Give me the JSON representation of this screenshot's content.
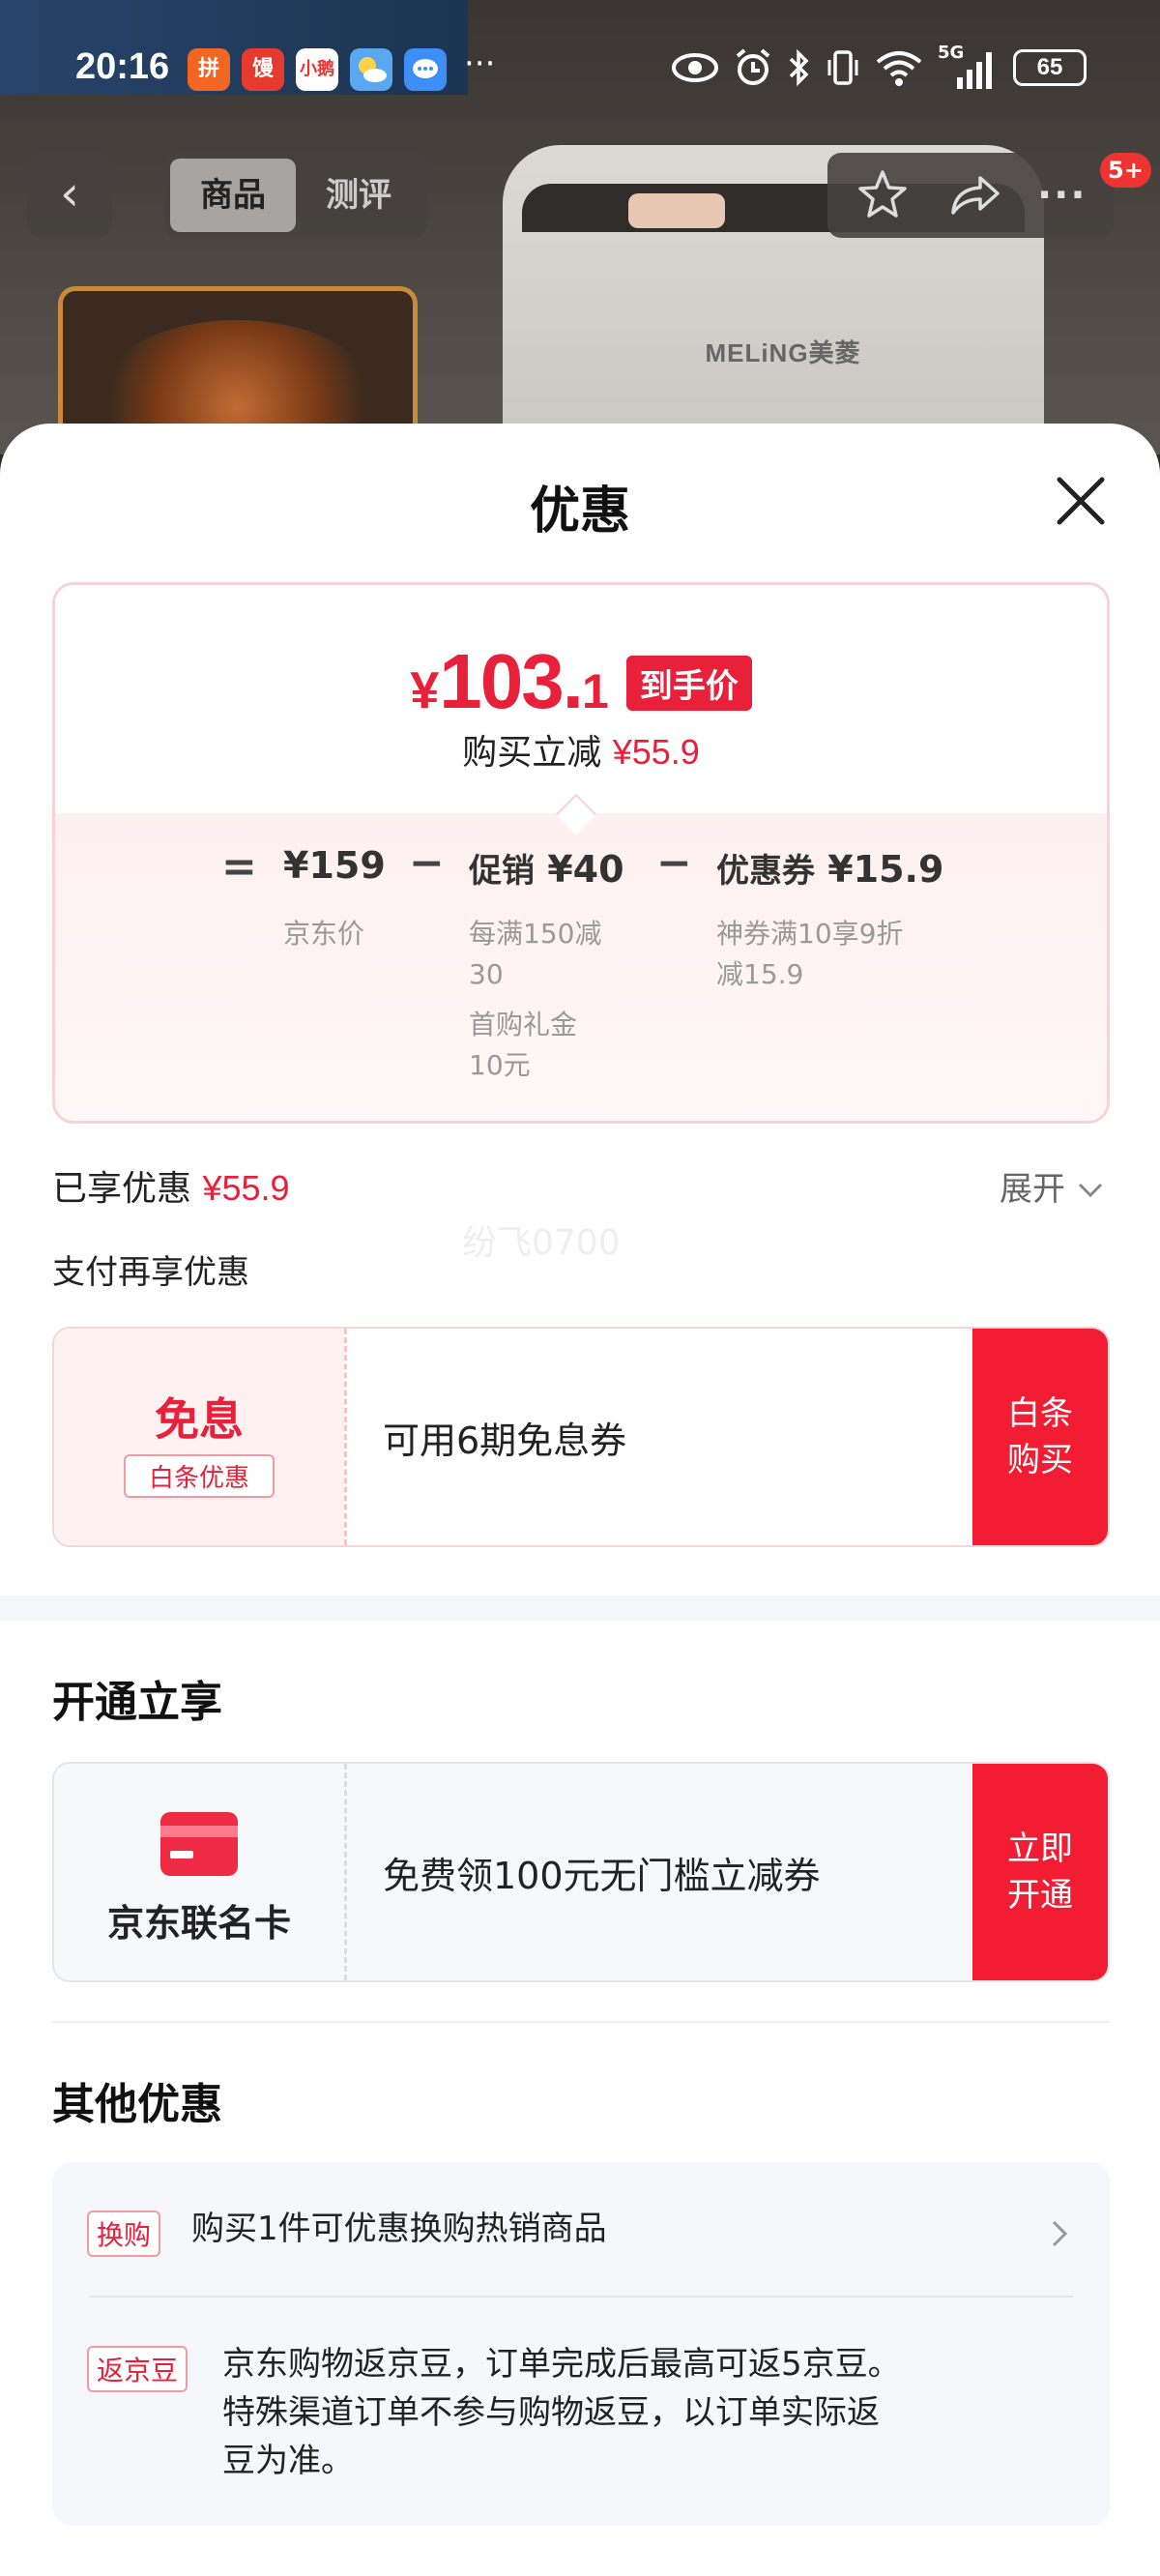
{
  "status_bar": {
    "time": "20:16",
    "app_icons": [
      "拼多多",
      "馒",
      "小鹅",
      "天气",
      "消息"
    ],
    "more": "···",
    "network": "5G",
    "battery": "65"
  },
  "nav": {
    "back": "‹",
    "tabs": [
      {
        "label": "商品",
        "active": true
      },
      {
        "label": "测评",
        "active": false
      }
    ],
    "more": "···",
    "badge": "5+"
  },
  "product_bg": {
    "brand": "MELiNG美菱",
    "thumb_text": ""
  },
  "sheet": {
    "title": "优惠",
    "price": {
      "currency": "¥",
      "integer": "103.",
      "decimal": "1",
      "tag": "到手价",
      "reduce_label": "购买立减",
      "reduce_value": "¥55.9"
    },
    "formula": {
      "eq": "=",
      "minus": "−",
      "jd_price": "¥159",
      "jd_price_label": "京东价",
      "promo_label": "促销",
      "promo_value": "¥40",
      "promo_note_1": "每满150减",
      "promo_note_1b": "30",
      "promo_note_2": "首购礼金",
      "promo_note_2b": "10元",
      "coupon_label": "优惠券",
      "coupon_value": "¥15.9",
      "coupon_note_1": "神券满10享9折",
      "coupon_note_1b": "减15.9"
    },
    "enjoyed_label": "已享优惠",
    "enjoyed_value": "¥55.9",
    "expand_label": "展开",
    "watermark": "纷飞0700",
    "pay_title": "支付再享优惠",
    "baitiao": {
      "main": "免息",
      "sub": "白条优惠",
      "text": "可用6期免息券",
      "button": "白条\n购买"
    },
    "open_title": "开通立享",
    "card": {
      "label": "京东联名卡",
      "text": "免费领100元无门槛立减券",
      "button": "立即\n开通"
    },
    "other_title": "其他优惠",
    "offers": [
      {
        "tag": "换购",
        "text": "购买1件可优惠换购热销商品"
      },
      {
        "tag": "返京豆",
        "text_1": "京东购物返京豆，订单完成后最高可返5京豆。",
        "text_2": "特殊渠道订单不参与购物返豆，以订单实际返",
        "text_3": "豆为准。"
      }
    ]
  },
  "colors": {
    "accent_red": "#e8203a",
    "button_red": "#f21c33",
    "card_border": "#f6d3d6"
  }
}
